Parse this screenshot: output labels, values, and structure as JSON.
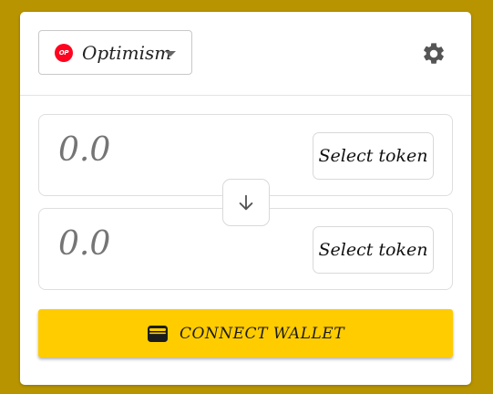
{
  "header": {
    "network": {
      "label": "Optimism",
      "logo_text": "OP",
      "logo_color": "#ff0420"
    },
    "settings_icon": "gear-icon"
  },
  "swap": {
    "from": {
      "amount": "0.0",
      "select_label": "Select token"
    },
    "to": {
      "amount": "0.0",
      "select_label": "Select token"
    },
    "swap_icon": "arrow-down-icon"
  },
  "connect": {
    "label": "CONNECT WALLET",
    "icon": "wallet-icon"
  },
  "colors": {
    "background": "#b89400",
    "accent": "#ffcc00",
    "card": "#ffffff"
  }
}
